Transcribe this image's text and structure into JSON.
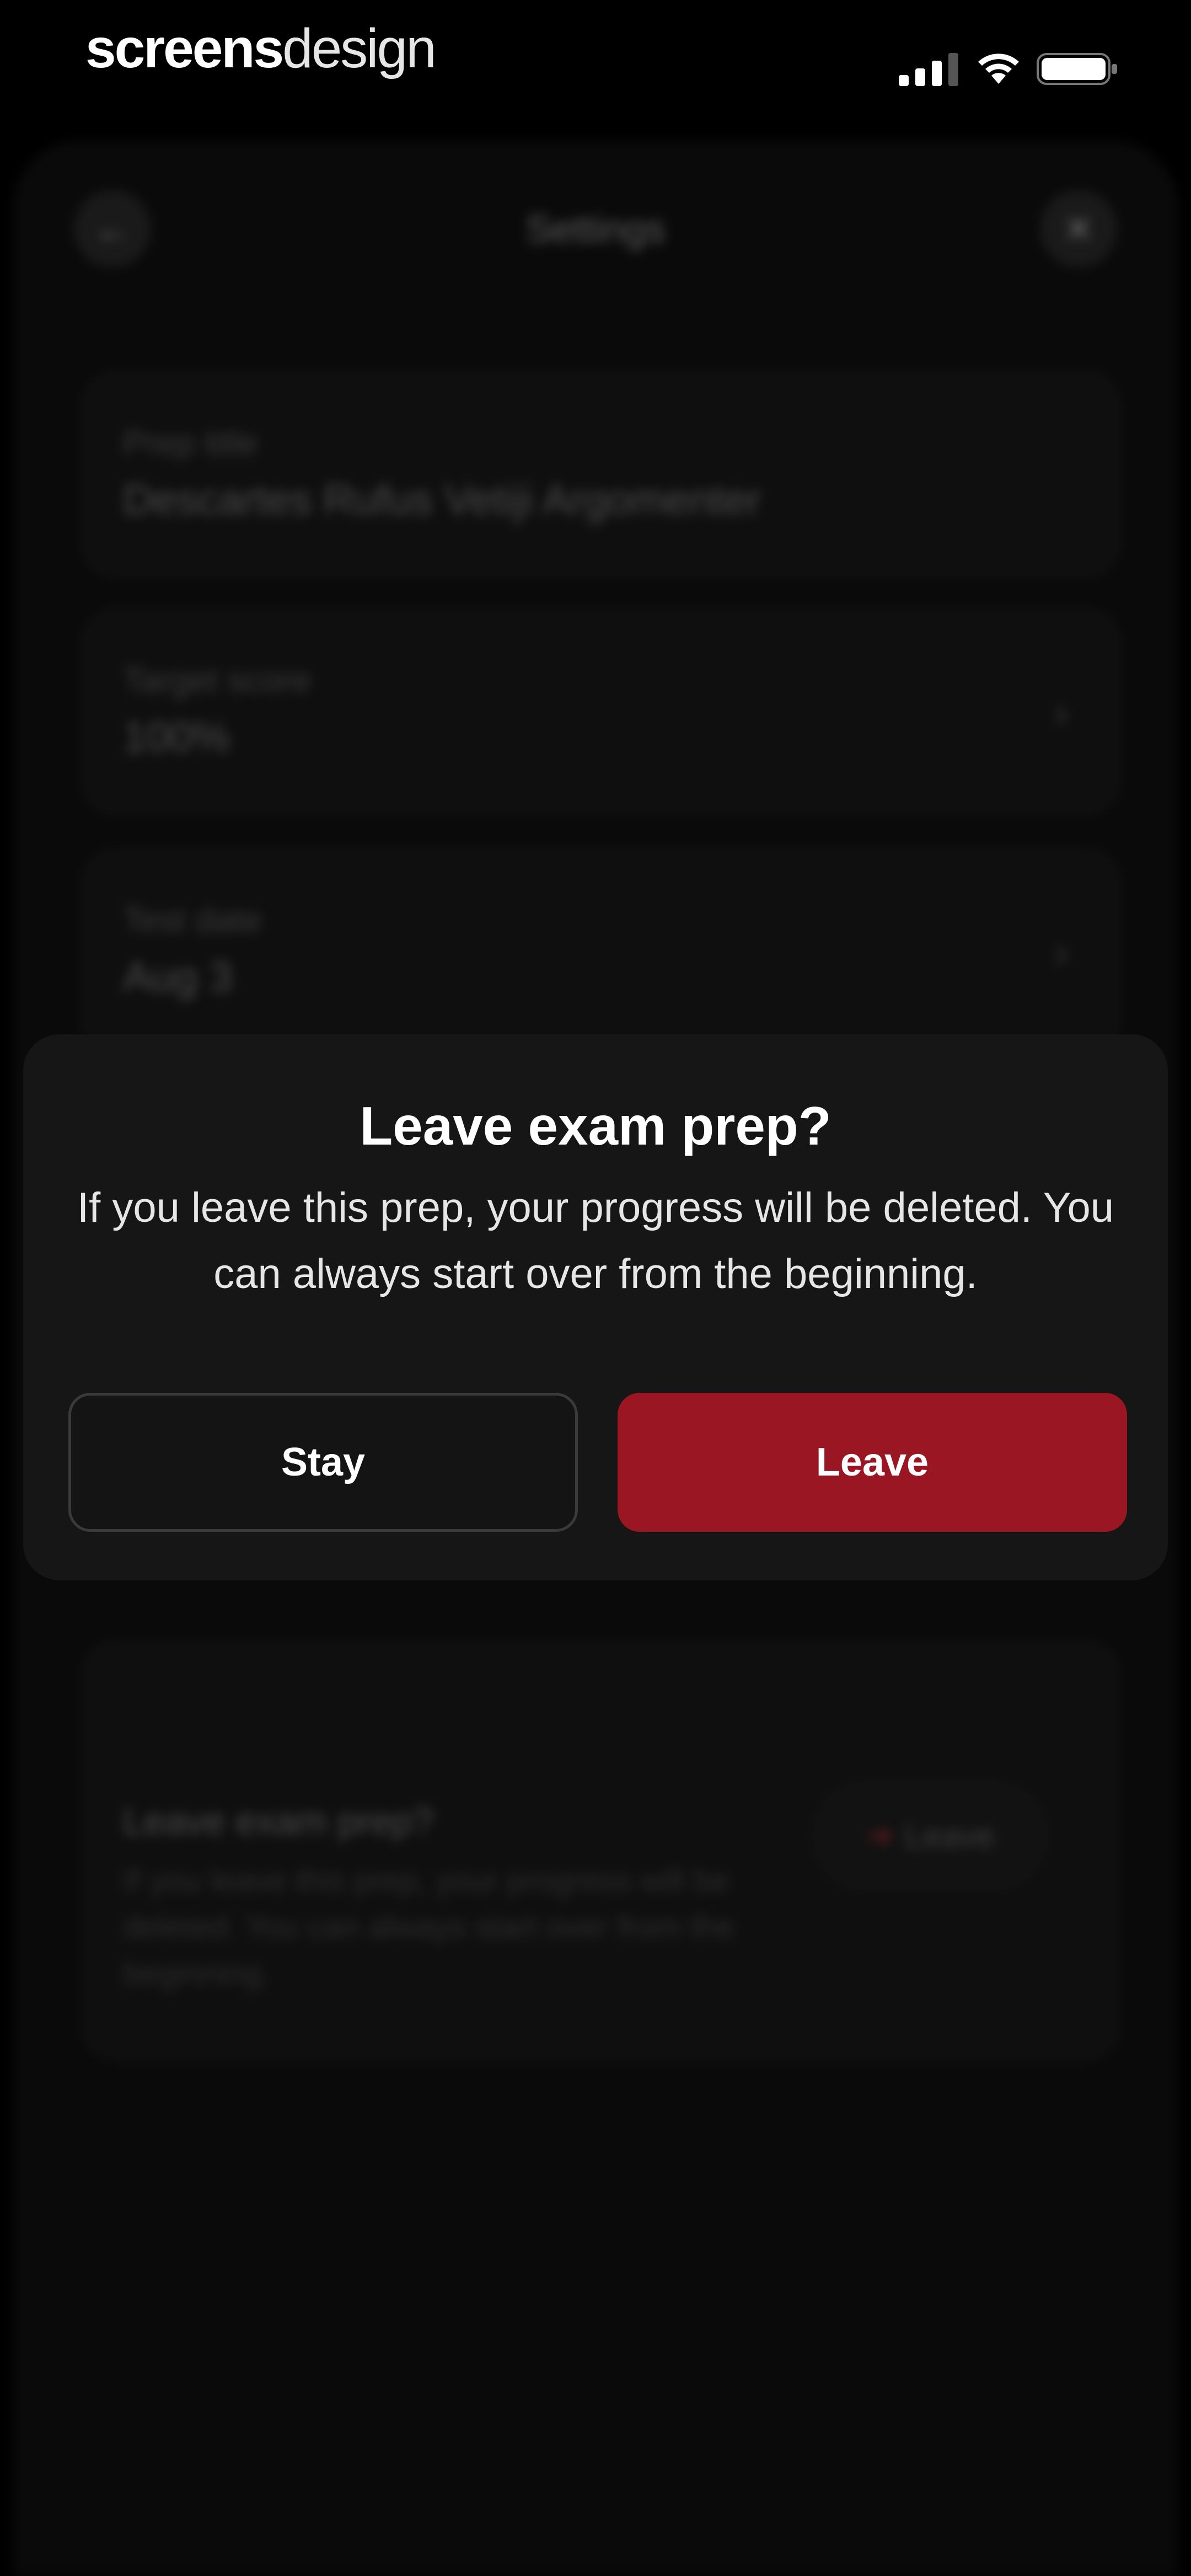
{
  "status_bar": {
    "brand_part1": "screens",
    "brand_part2": "design"
  },
  "background_sheet": {
    "title": "Settings",
    "fields": [
      {
        "label": "Prep title",
        "value": "Descartes Rufus Vetiji Argomenter"
      },
      {
        "label": "Target score",
        "value": "100%"
      },
      {
        "label": "Test date",
        "value": "Aug 3"
      }
    ],
    "leave_card": {
      "title": "Leave exam prep?",
      "body": "If you leave this prep, your progress will be deleted. You can always start over from the beginning.",
      "button_label": "Leave"
    }
  },
  "dialog": {
    "title": "Leave exam prep?",
    "message": "If you leave this prep, your progress will be deleted. You can always start over from the beginning.",
    "stay_label": "Stay",
    "leave_label": "Leave"
  },
  "colors": {
    "leave_accent": "#9b1623",
    "dialog_bg": "#161616",
    "page_bg": "#000000"
  }
}
